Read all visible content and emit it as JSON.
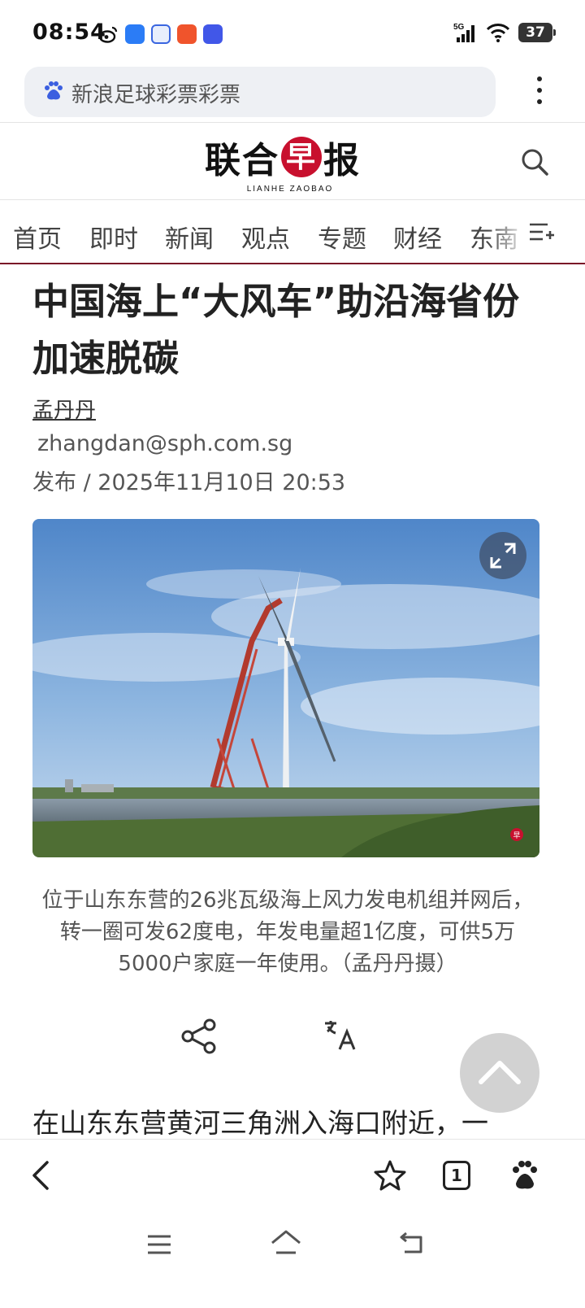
{
  "status_bar": {
    "time": "08:54",
    "network": "5G",
    "battery": "37"
  },
  "browser": {
    "search_query": "新浪足球彩票彩票",
    "tab_count": "1"
  },
  "site": {
    "logo_cn_left": "联合",
    "logo_cn_circle": "早",
    "logo_cn_right": "报",
    "logo_en": "LIANHE ZAOBAO"
  },
  "nav": {
    "tabs": [
      "首页",
      "即时",
      "新闻",
      "观点",
      "专题",
      "财经",
      "东南"
    ]
  },
  "article": {
    "title": "中国海上“大风车”助沿海省份加速脱碳",
    "author": "孟丹丹",
    "email": "zhangdan@sph.com.sg",
    "date": "发布 / 2025年11月10日 20:53",
    "caption": "位于山东东营的26兆瓦级海上风力发电机组并网后，转一圈可发62度电，年发电量超1亿度，可供5万5000户家庭一年使用。（孟丹丹摄）",
    "watermark": "早",
    "body_start": "在山东东营黄河三角洲入海口附近，一"
  },
  "colors": {
    "brand_red": "#c8102e",
    "nav_underline": "#7a1428"
  }
}
